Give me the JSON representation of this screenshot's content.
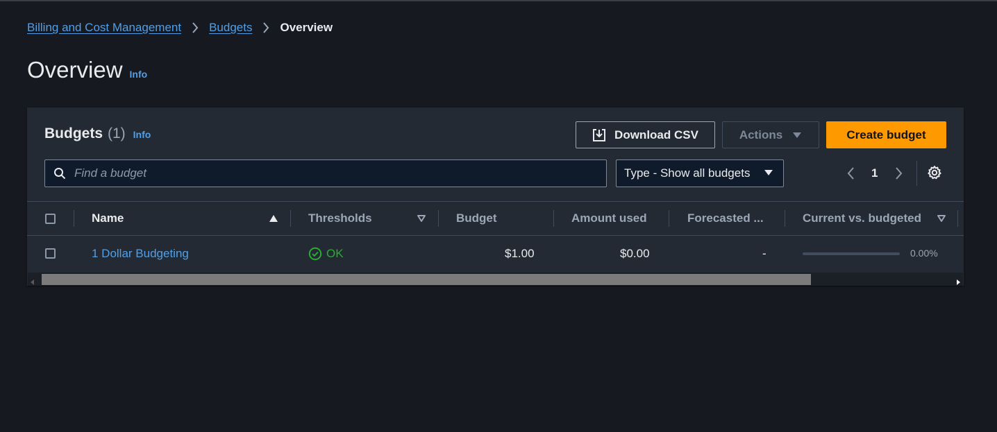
{
  "breadcrumb": {
    "items": [
      "Billing and Cost Management",
      "Budgets"
    ],
    "current": "Overview"
  },
  "page": {
    "title": "Overview",
    "info": "Info"
  },
  "budgets": {
    "title": "Budgets",
    "count": "(1)",
    "info": "Info",
    "download_label": "Download CSV",
    "actions_label": "Actions",
    "create_label": "Create budget",
    "search_placeholder": "Find a budget",
    "type_filter": "Type - Show all budgets",
    "page": "1"
  },
  "table": {
    "columns": [
      "Name",
      "Thresholds",
      "Budget",
      "Amount used",
      "Forecasted ...",
      "Current vs. budgeted"
    ],
    "rows": [
      {
        "name": "1 Dollar Budgeting",
        "threshold": "OK",
        "budget": "$1.00",
        "amount_used": "$0.00",
        "forecasted": "-",
        "current_vs_budgeted_pct": "0.00%",
        "progress_fraction": 0.0
      }
    ]
  },
  "colors": {
    "accent_link": "#539fe5",
    "primary_button": "#ff9900",
    "status_ok": "#29ad32",
    "background": "#161920",
    "panel": "#232a33"
  },
  "icons": [
    "chevron-right-icon",
    "download-icon",
    "caret-down-icon",
    "search-icon",
    "chevron-left-icon",
    "gear-icon",
    "sort-ascending-icon",
    "sort-descending-icon",
    "check-circle-icon"
  ]
}
